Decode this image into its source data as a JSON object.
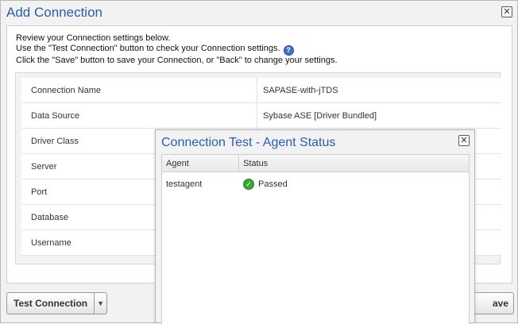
{
  "dialog": {
    "title": "Add Connection",
    "close_icon": "close-icon"
  },
  "intro": {
    "line1": "Review your Connection settings below.",
    "line2": "Use the \"Test Connection\" button to check your Connection settings.",
    "line3": "Click the \"Save\" button to save your Connection, or \"Back\" to change your settings.",
    "help_icon": "help-icon"
  },
  "settings": {
    "rows": [
      {
        "label": "Connection Name",
        "value": "SAPASE-with-jTDS"
      },
      {
        "label": "Data Source",
        "value": "Sybase ASE [Driver Bundled]"
      },
      {
        "label": "Driver Class",
        "value": ""
      },
      {
        "label": "Server",
        "value": ""
      },
      {
        "label": "Port",
        "value": ""
      },
      {
        "label": "Database",
        "value": ""
      },
      {
        "label": "Username",
        "value": ""
      }
    ]
  },
  "footer": {
    "test_connection_label": "Test Connection",
    "save_label_visible": "ave"
  },
  "modal": {
    "title": "Connection Test - Agent Status",
    "columns": [
      "Agent",
      "Status"
    ],
    "rows": [
      {
        "agent": "testagent",
        "status": "Passed",
        "status_icon": "check-circle-icon"
      }
    ]
  },
  "colors": {
    "title_blue": "#2a5db0",
    "pass_green": "#39a839"
  }
}
